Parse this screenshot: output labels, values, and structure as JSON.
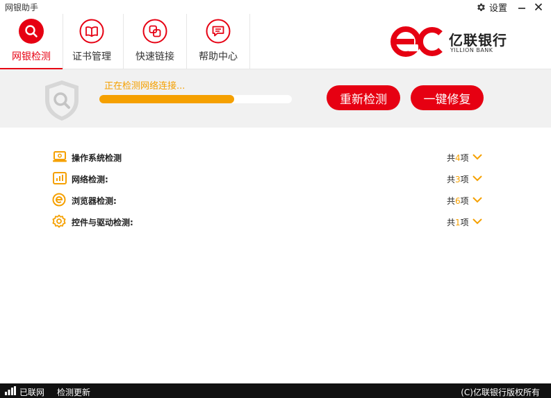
{
  "window": {
    "title": "网银助手",
    "settings_label": "设置"
  },
  "nav": {
    "tabs": [
      {
        "label": "网银检测",
        "icon": "search-icon",
        "active": true
      },
      {
        "label": "证书管理",
        "icon": "book-icon",
        "active": false
      },
      {
        "label": "快速链接",
        "icon": "link-icon",
        "active": false
      },
      {
        "label": "帮助中心",
        "icon": "chat-icon",
        "active": false
      }
    ]
  },
  "brand": {
    "name_cn": "亿联银行",
    "name_en": "YILLION BANK",
    "color": "#e60012"
  },
  "status": {
    "message": "正在检测网络连接...",
    "progress": 0.7,
    "recheck_label": "重新检测",
    "repair_label": "一键修复"
  },
  "checks": [
    {
      "label": "操作系统检测",
      "icon": "laptop-icon",
      "prefix": "共",
      "count": "4",
      "suffix": "项"
    },
    {
      "label": "网络检测:",
      "icon": "bar-chart-icon",
      "prefix": "共",
      "count": "3",
      "suffix": "项"
    },
    {
      "label": "浏览器检测:",
      "icon": "browser-icon",
      "prefix": "共",
      "count": "6",
      "suffix": "项"
    },
    {
      "label": "控件与驱动检测:",
      "icon": "gear-icon",
      "prefix": "共",
      "count": "1",
      "suffix": "项"
    }
  ],
  "statusbar": {
    "connection": "已联网",
    "update_label": "检测更新",
    "copyright": "(C)亿联银行版权所有"
  },
  "colors": {
    "accent": "#e60012",
    "highlight": "#f5a000"
  }
}
